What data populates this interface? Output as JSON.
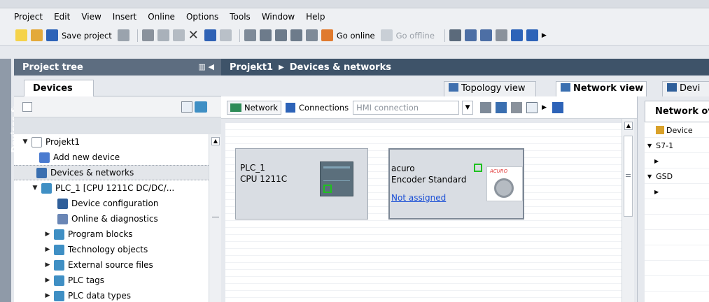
{
  "menu": [
    "Project",
    "Edit",
    "View",
    "Insert",
    "Online",
    "Options",
    "Tools",
    "Window",
    "Help"
  ],
  "toolbar": {
    "save_label": "Save project",
    "go_online_label": "Go online",
    "go_offline_label": "Go offline"
  },
  "side_tab": "Devices & networks",
  "project_tree": {
    "title": "Project tree",
    "tab": "Devices",
    "items": [
      {
        "label": "Projekt1",
        "arrow": "▼",
        "icon": "project-icon",
        "color": "#ffffff"
      },
      {
        "label": "Add new device",
        "arrow": "",
        "icon": "add-device-icon",
        "color": "#4a7bd0"
      },
      {
        "label": "Devices & networks",
        "arrow": "",
        "icon": "network-icon",
        "color": "#3a6fb0"
      },
      {
        "label": "PLC_1 [CPU 1211C DC/DC/...",
        "arrow": "▼",
        "icon": "plc-icon",
        "color": "#3f8fc4"
      },
      {
        "label": "Device configuration",
        "arrow": "",
        "icon": "device-config-icon",
        "color": "#2f5f9a"
      },
      {
        "label": "Online & diagnostics",
        "arrow": "",
        "icon": "diagnostics-icon",
        "color": "#6a86b5"
      },
      {
        "label": "Program blocks",
        "arrow": "▶",
        "icon": "program-blocks-icon",
        "color": "#3f8fc4"
      },
      {
        "label": "Technology objects",
        "arrow": "▶",
        "icon": "technology-objects-icon",
        "color": "#3f8fc4"
      },
      {
        "label": "External source files",
        "arrow": "▶",
        "icon": "source-files-icon",
        "color": "#3f8fc4"
      },
      {
        "label": "PLC tags",
        "arrow": "▶",
        "icon": "plc-tags-icon",
        "color": "#3f8fc4"
      },
      {
        "label": "PLC data types",
        "arrow": "▶",
        "icon": "data-types-icon",
        "color": "#3f8fc4"
      }
    ]
  },
  "breadcrumb": {
    "project": "Projekt1",
    "separator": "▶",
    "page": "Devices & networks"
  },
  "view_tabs": {
    "topology": "Topology view",
    "network": "Network view",
    "device": "Devi"
  },
  "network_toolbar": {
    "network_label": "Network",
    "connections_label": "Connections",
    "connection_type": "HMI connection"
  },
  "devices": {
    "plc": {
      "name": "PLC_1",
      "type": "CPU 1211C"
    },
    "encoder": {
      "name": "acuro",
      "type": "Encoder Standard",
      "link": "Not assigned",
      "brand": "ACURO"
    }
  },
  "overview": {
    "tab": "Network ov",
    "rows": [
      {
        "label": "Device",
        "arrow": ""
      },
      {
        "label": "S7-1",
        "arrow": "▼"
      },
      {
        "label": "",
        "arrow": "▶"
      },
      {
        "label": "GSD",
        "arrow": "▼"
      },
      {
        "label": "",
        "arrow": "▶"
      }
    ]
  },
  "colors": {
    "accent": "#3e5369",
    "header_dark": "#5d6d80",
    "selection": "#e3e6ea",
    "link": "#1a4fd6",
    "status_green": "#1fc11f"
  }
}
